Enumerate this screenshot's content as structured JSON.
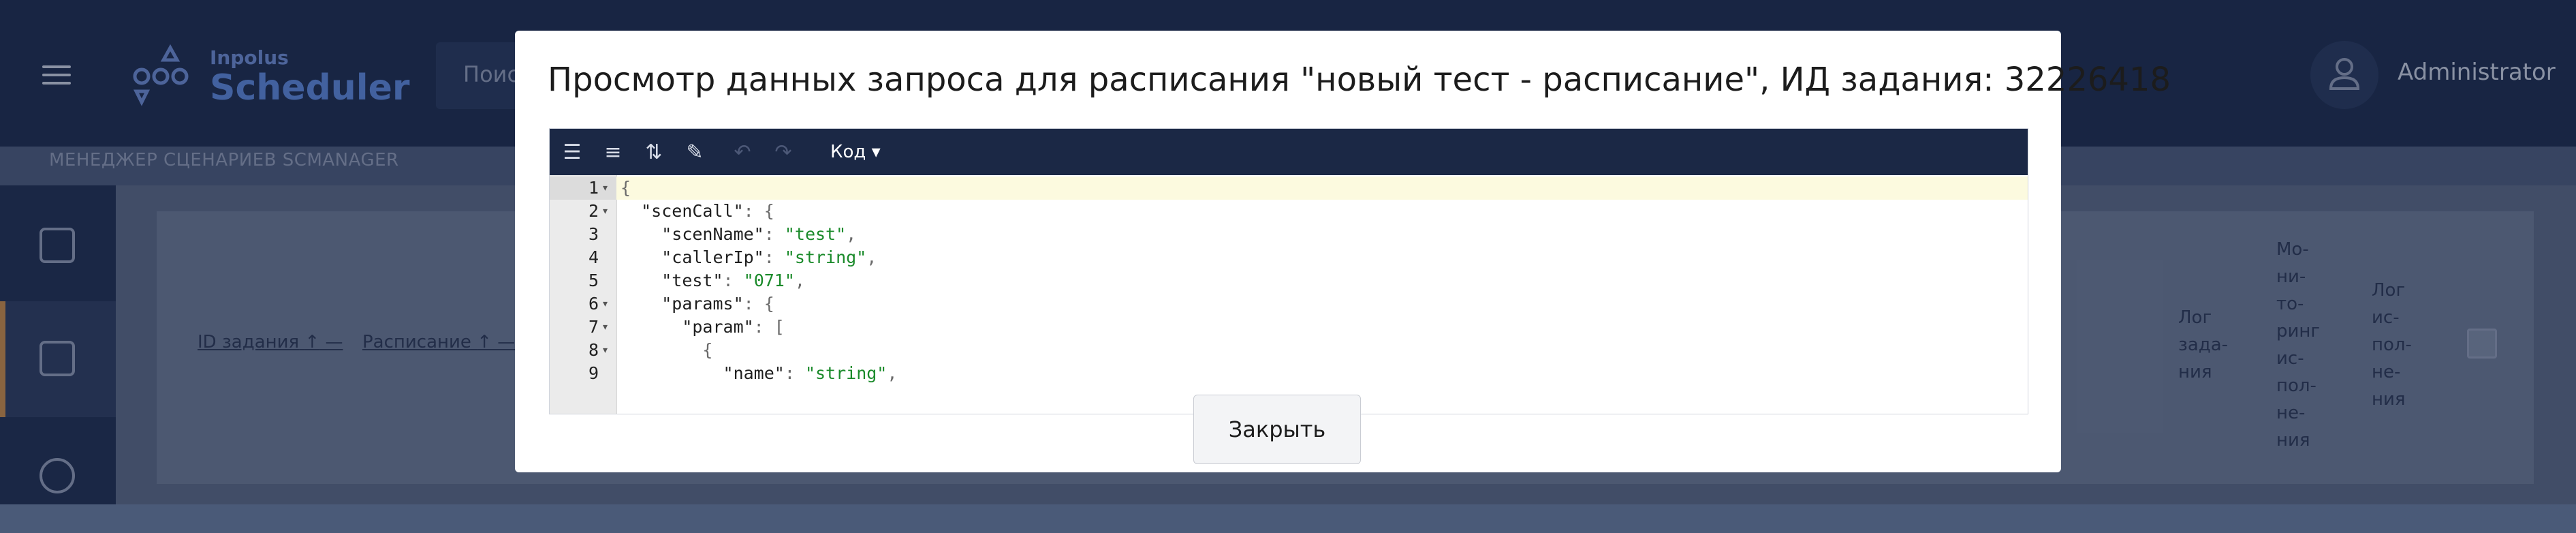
{
  "app": {
    "logo_line1": "Inpolus",
    "logo_line2": "Scheduler",
    "search_placeholder": "Поис",
    "user_name": "Administrator",
    "subheader": "МЕНЕДЖЕР СЦЕНАРИЕВ SCMANAGER"
  },
  "table": {
    "columns": [
      {
        "label": "ID задания",
        "sort": "↑"
      },
      {
        "label": "Расписание",
        "sort": "↑"
      },
      {
        "label": "Лог\nзада-\nния"
      },
      {
        "label": "Мо-\nни-\nто-\nринг\nис-\nпол-\nне-\nния"
      },
      {
        "label": "Лог\nис-\nпол-\nне-\nния"
      }
    ]
  },
  "modal": {
    "title": "Просмотр данных запроса для расписания \"новый тест - расписание\", ИД задания: 32226418",
    "mode_label": "Код ▾",
    "close_label": "Закрыть",
    "toolbar_icons": [
      "format-icon",
      "compact-icon",
      "sort-icon",
      "wrench-icon",
      "undo-icon",
      "redo-icon"
    ],
    "code_lines": [
      {
        "n": "1",
        "fold": true,
        "indent": "",
        "key": "",
        "val": "",
        "punct": "{"
      },
      {
        "n": "2",
        "fold": true,
        "indent": "  ",
        "key": "\"scenCall\"",
        "val": "",
        "punct": ": {"
      },
      {
        "n": "3",
        "fold": false,
        "indent": "    ",
        "key": "\"scenName\"",
        "val": "\"test\"",
        "punct": ","
      },
      {
        "n": "4",
        "fold": false,
        "indent": "    ",
        "key": "\"callerIp\"",
        "val": "\"string\"",
        "punct": ","
      },
      {
        "n": "5",
        "fold": false,
        "indent": "    ",
        "key": "\"test\"",
        "val": "\"071\"",
        "punct": ","
      },
      {
        "n": "6",
        "fold": true,
        "indent": "    ",
        "key": "\"params\"",
        "val": "",
        "punct": ": {"
      },
      {
        "n": "7",
        "fold": true,
        "indent": "      ",
        "key": "\"param\"",
        "val": "",
        "punct": ": ["
      },
      {
        "n": "8",
        "fold": true,
        "indent": "        ",
        "key": "",
        "val": "",
        "punct": "{"
      },
      {
        "n": "9",
        "fold": false,
        "indent": "          ",
        "key": "\"name\"",
        "val": "\"string\"",
        "punct": ","
      }
    ]
  }
}
